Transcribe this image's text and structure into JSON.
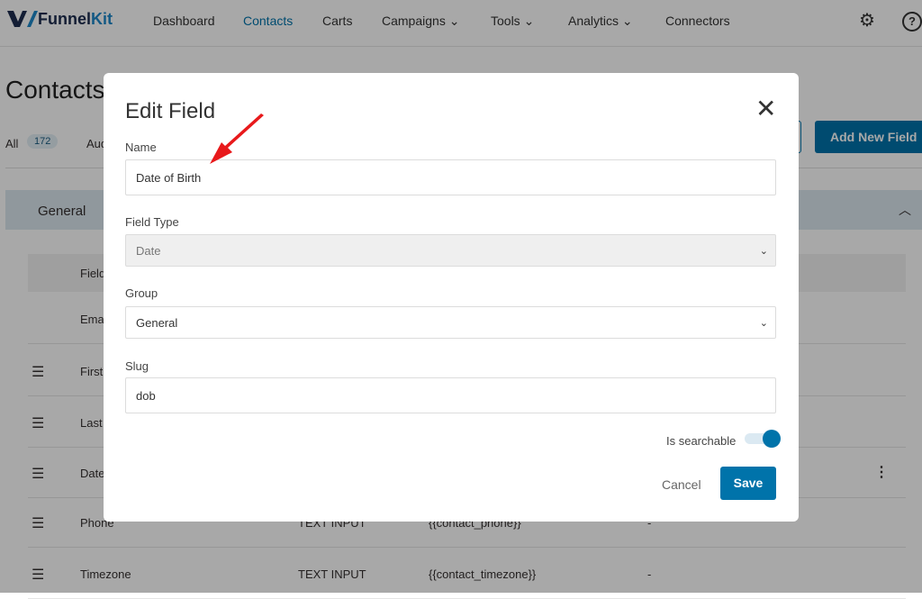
{
  "nav": {
    "logo_a": "Funnel",
    "logo_b": "Kit",
    "items": [
      "Dashboard",
      "Contacts",
      "Carts",
      "Campaigns",
      "Tools",
      "Analytics",
      "Connectors"
    ],
    "active": "Contacts"
  },
  "page": {
    "title": "Contacts",
    "tab_all": "All",
    "tab_all_count": "172",
    "tab_audiences": "Audiences",
    "add_button": "Add New Field",
    "group": "General"
  },
  "table": {
    "header": "Field",
    "rows": [
      {
        "name": "Email",
        "type": "",
        "merge": "",
        "extra": ""
      },
      {
        "name": "First Name",
        "type": "",
        "merge": "",
        "extra": ""
      },
      {
        "name": "Last Name",
        "type": "",
        "merge": "",
        "extra": ""
      },
      {
        "name": "Date of Birth",
        "type": "",
        "merge": "",
        "extra": ""
      },
      {
        "name": "Phone",
        "type": "TEXT INPUT",
        "merge": "{{contact_phone}}",
        "extra": "-"
      },
      {
        "name": "Timezone",
        "type": "TEXT INPUT",
        "merge": "{{contact_timezone}}",
        "extra": "-"
      }
    ]
  },
  "modal": {
    "title": "Edit Field",
    "name_label": "Name",
    "name_value": "Date of Birth",
    "type_label": "Field Type",
    "type_value": "Date",
    "group_label": "Group",
    "group_value": "General",
    "slug_label": "Slug",
    "slug_value": "dob",
    "searchable_label": "Is searchable",
    "searchable": true,
    "cancel": "Cancel",
    "save": "Save"
  },
  "colors": {
    "accent": "#0073aa",
    "annotation_arrow": "#e8191b"
  }
}
